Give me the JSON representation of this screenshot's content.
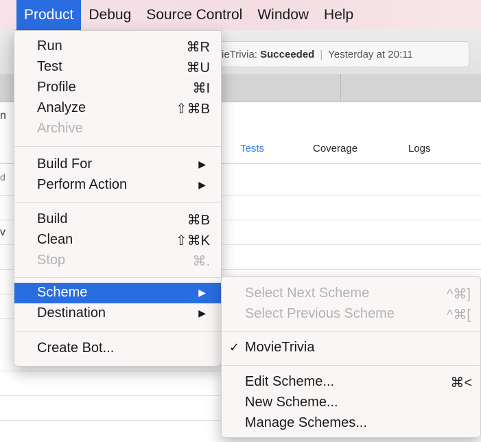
{
  "menubar": {
    "items": [
      "Product",
      "Debug",
      "Source Control",
      "Window",
      "Help"
    ]
  },
  "activity": {
    "project": "ieTrivia:",
    "status": "Succeeded",
    "time": "Yesterday at 20:11"
  },
  "subtabs": {
    "tests": "Tests",
    "coverage": "Coverage",
    "logs": "Logs"
  },
  "edge_chars": [
    "n",
    "d",
    "v"
  ],
  "product_menu": {
    "items": [
      {
        "label": "Run",
        "shortcut": "⌘R"
      },
      {
        "label": "Test",
        "shortcut": "⌘U"
      },
      {
        "label": "Profile",
        "shortcut": "⌘I"
      },
      {
        "label": "Analyze",
        "shortcut": "⇧⌘B"
      },
      {
        "label": "Archive",
        "shortcut": ""
      },
      {
        "label": "Build For",
        "arrow": "▶"
      },
      {
        "label": "Perform Action",
        "arrow": "▶"
      },
      {
        "label": "Build",
        "shortcut": "⌘B"
      },
      {
        "label": "Clean",
        "shortcut": "⇧⌘K"
      },
      {
        "label": "Stop",
        "shortcut": "⌘."
      },
      {
        "label": "Scheme",
        "arrow": "▶"
      },
      {
        "label": "Destination",
        "arrow": "▶"
      },
      {
        "label": "Create Bot...",
        "shortcut": ""
      }
    ]
  },
  "scheme_menu": {
    "items": [
      {
        "label": "Select Next Scheme",
        "shortcut": "^⌘]"
      },
      {
        "label": "Select Previous Scheme",
        "shortcut": "^⌘["
      },
      {
        "label": "MovieTrivia",
        "check": "✓"
      },
      {
        "label": "Edit Scheme...",
        "shortcut": "⌘<"
      },
      {
        "label": "New Scheme...",
        "shortcut": ""
      },
      {
        "label": "Manage Schemes...",
        "shortcut": ""
      }
    ]
  },
  "colors": {
    "highlight": "#2a6de0",
    "disabled_text": "#b3b3b3",
    "tab_selected": "#2f7bf5"
  }
}
